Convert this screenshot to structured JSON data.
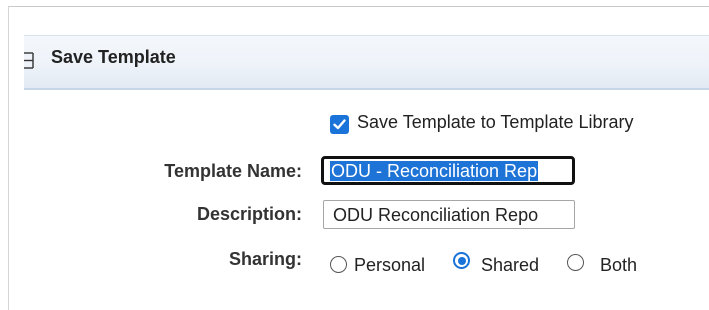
{
  "panel": {
    "title": "Save Template",
    "collapse_icon": "collapse-icon"
  },
  "save_to_library": {
    "label": "Save Template to Template Library",
    "checked": true
  },
  "fields": {
    "template_name": {
      "label": "Template Name:",
      "value": "ODU - Reconciliation Rep"
    },
    "description": {
      "label": "Description:",
      "value": "ODU Reconciliation Repo"
    }
  },
  "sharing": {
    "label": "Sharing:",
    "options": [
      {
        "label": "Personal",
        "checked": false
      },
      {
        "label": "Shared",
        "checked": true
      },
      {
        "label": "Both",
        "checked": false
      }
    ]
  },
  "colors": {
    "accent": "#1a73d9",
    "panel_header": "#eef3f9",
    "selection": "#1e74d6"
  }
}
